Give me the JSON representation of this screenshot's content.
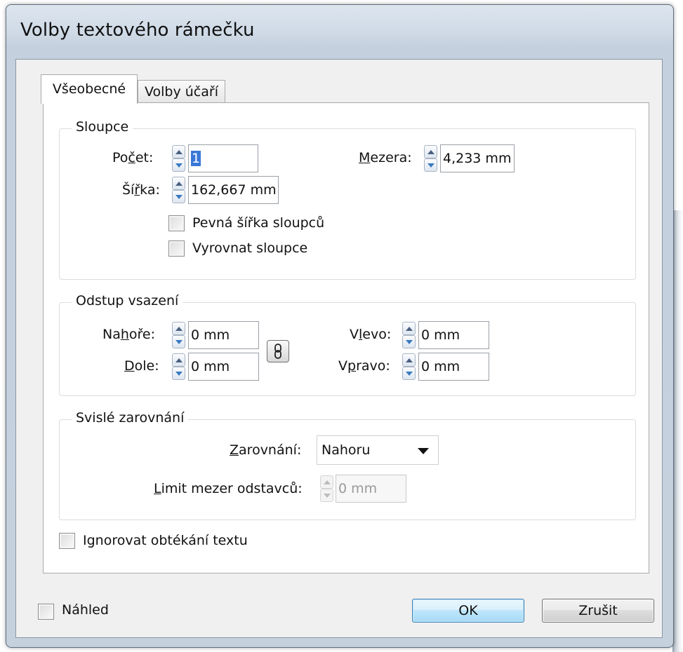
{
  "dialog": {
    "title": "Volby textového rámečku"
  },
  "tabs": [
    {
      "label": "Všeobecné",
      "active": true
    },
    {
      "label": "Volby účaří",
      "active": false
    }
  ],
  "columns": {
    "group_title": "Sloupce",
    "count": {
      "label_pre": "Po",
      "label_mn": "č",
      "label_post": "et:",
      "value": "1"
    },
    "gutter": {
      "label_mn": "M",
      "label_post": "ezera:",
      "value": "4,233 mm"
    },
    "width": {
      "label_pre": "Ší",
      "label_mn": "ř",
      "label_post": "ka:",
      "value": "162,667 mm"
    },
    "fixed_width": {
      "label": "Pevná šířka sloupců",
      "checked": false
    },
    "balance": {
      "label": "Vyrovnat sloupce",
      "checked": false
    }
  },
  "inset": {
    "group_title": "Odstup vsazení",
    "top": {
      "label_pre": "Na",
      "label_mn": "h",
      "label_post": "oře:",
      "value": "0 mm"
    },
    "bottom": {
      "label_mn": "D",
      "label_post": "ole:",
      "value": "0 mm"
    },
    "left": {
      "label_pre": "V",
      "label_mn": "l",
      "label_post": "evo:",
      "value": "0 mm"
    },
    "right": {
      "label_pre": "V",
      "label_mn": "p",
      "label_post": "ravo:",
      "value": "0 mm"
    },
    "link_icon": "chain-link-icon"
  },
  "vertical": {
    "group_title": "Svislé zarovnání",
    "align": {
      "label_mn": "Z",
      "label_post": "arovnání:",
      "value": "Nahoru"
    },
    "para_limit": {
      "label_mn": "L",
      "label_post": "imit mezer odstavců:",
      "value": "0 mm"
    }
  },
  "ignore_wrap": {
    "label": "Ignorovat obtékání textu",
    "checked": false
  },
  "preview": {
    "label": "Náhled",
    "checked": false
  },
  "buttons": {
    "ok": "OK",
    "cancel": "Zrušit"
  },
  "colors": {
    "accent_selection": "#3a78d8",
    "ok_border": "#3c7fb1"
  }
}
